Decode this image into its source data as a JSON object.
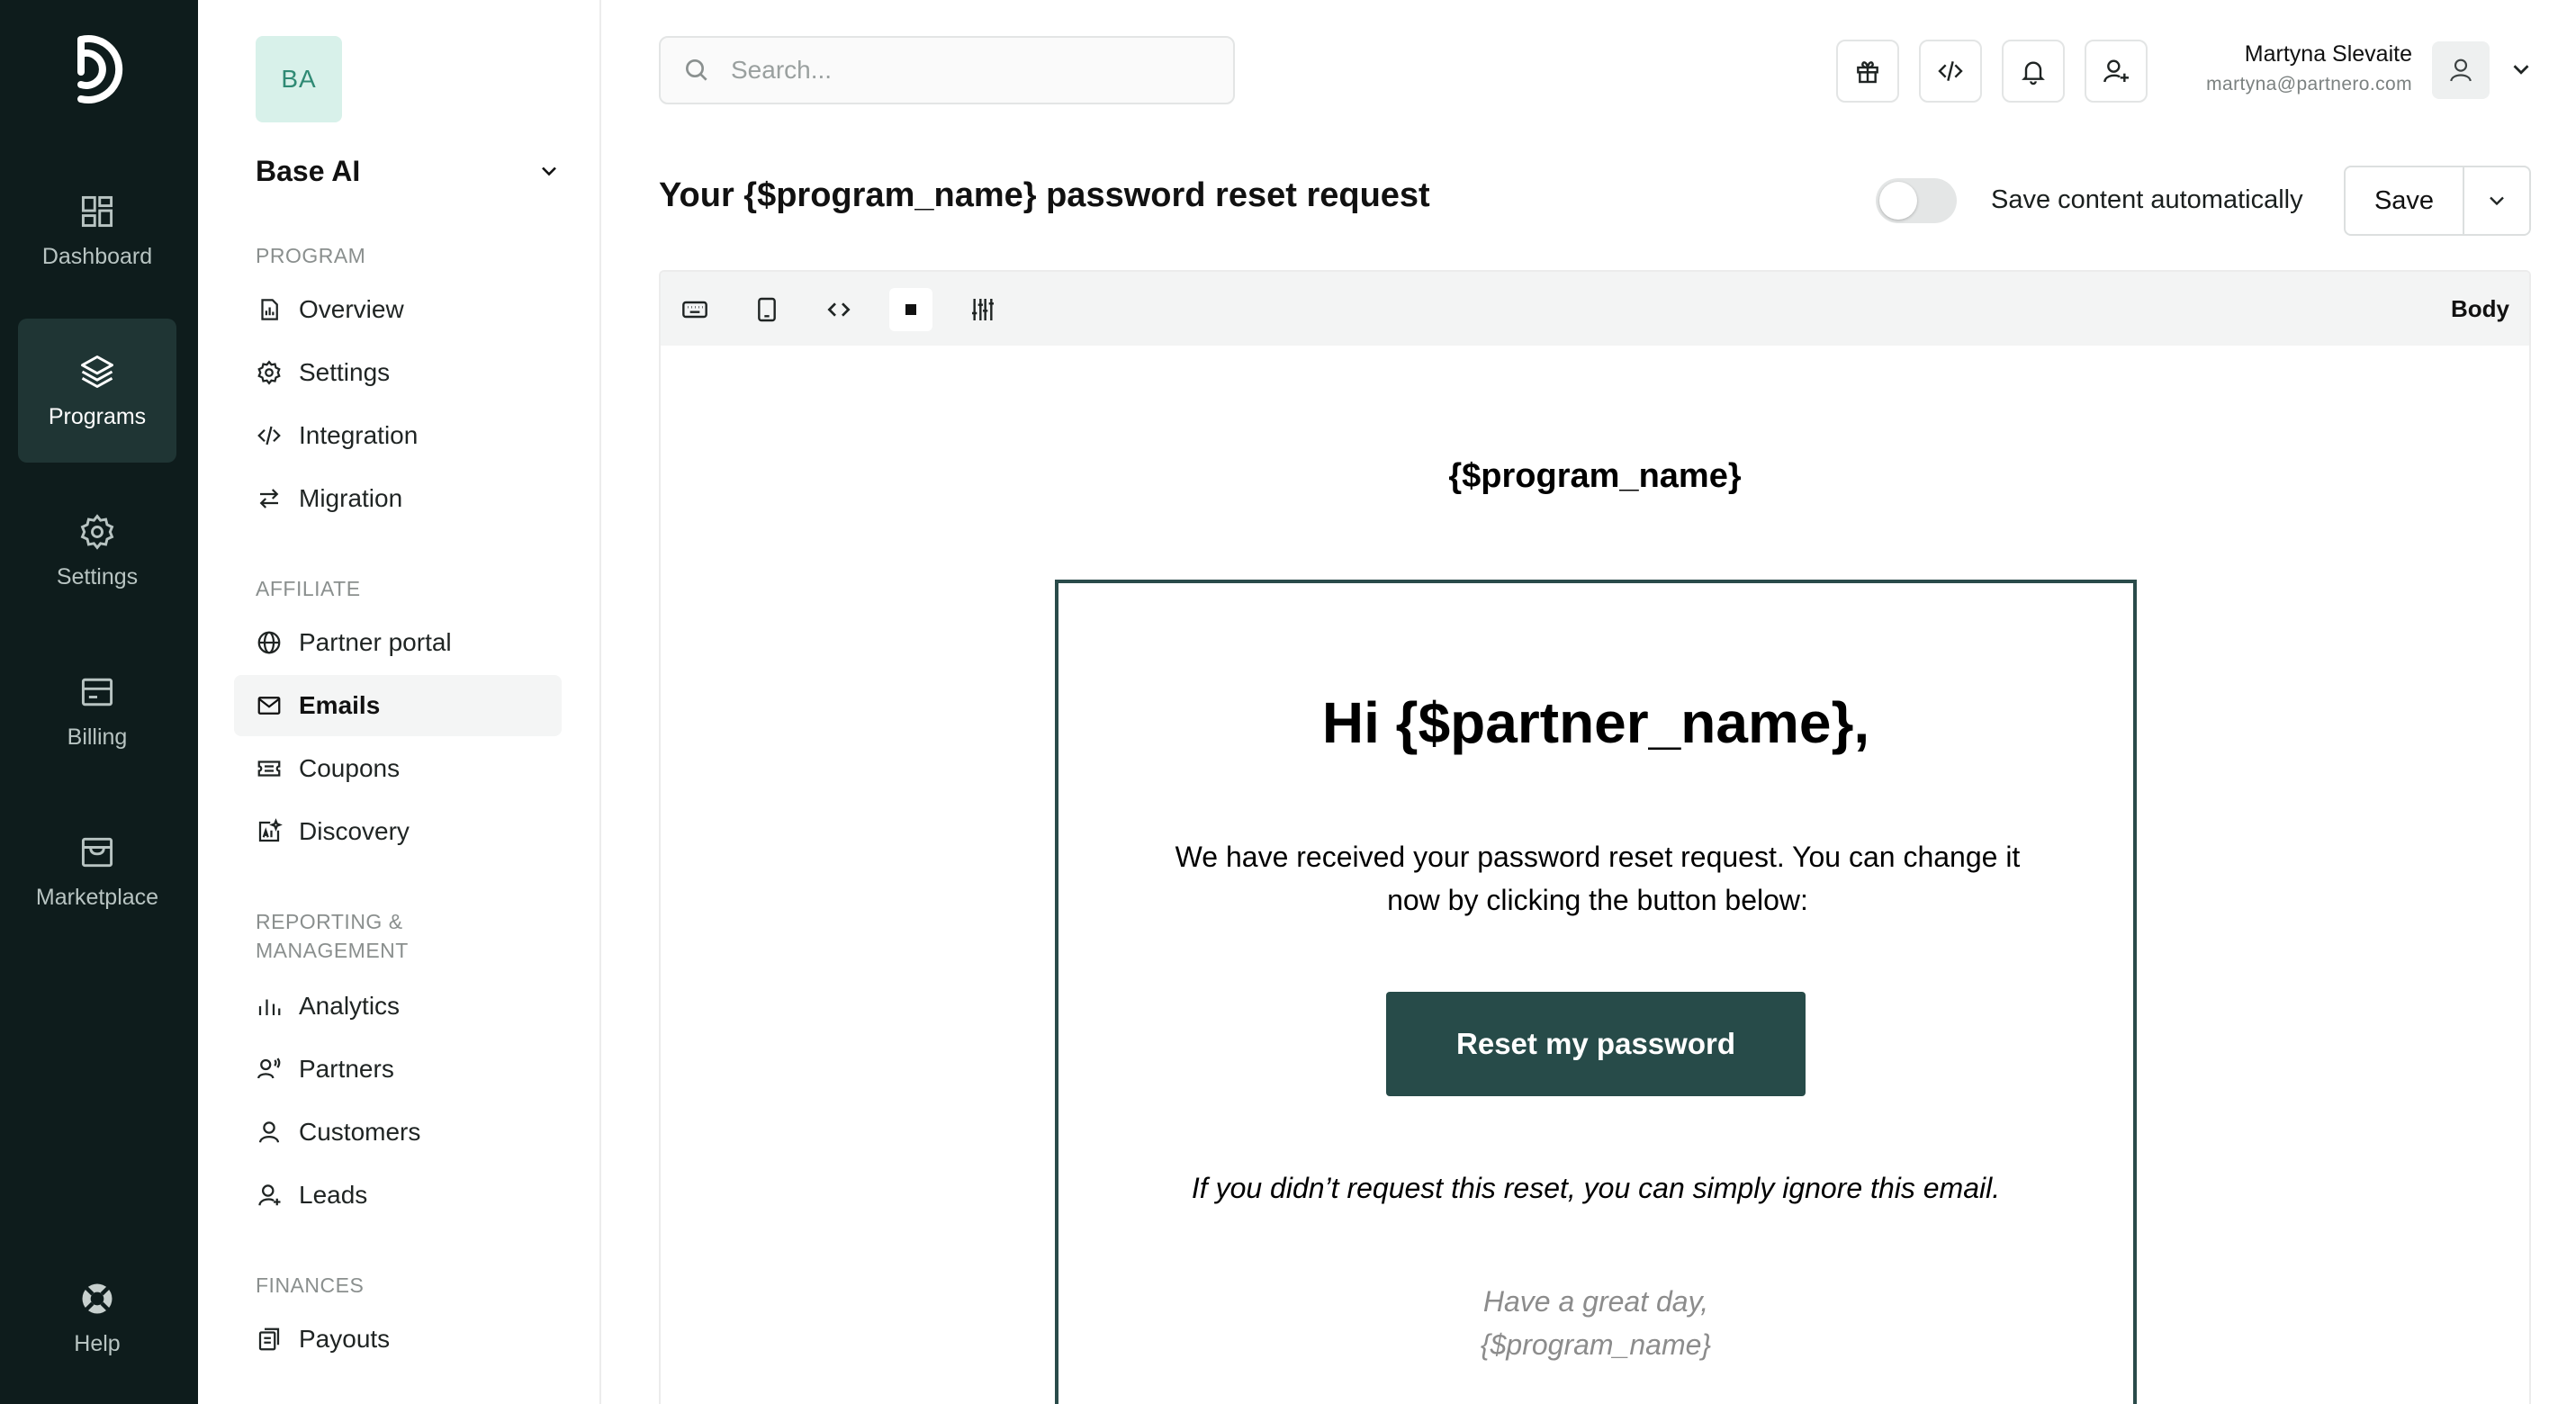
{
  "rail": {
    "items": [
      {
        "label": "Dashboard",
        "icon": "dashboard-icon",
        "active": false
      },
      {
        "label": "Programs",
        "icon": "layers-icon",
        "active": true
      },
      {
        "label": "Settings",
        "icon": "gear-icon",
        "active": false
      },
      {
        "label": "Billing",
        "icon": "billing-icon",
        "active": false
      },
      {
        "label": "Marketplace",
        "icon": "store-icon",
        "active": false
      }
    ],
    "help": {
      "label": "Help",
      "icon": "lifebuoy-icon"
    }
  },
  "sidebar": {
    "avatar": "BA",
    "org_name": "Base AI",
    "sections": [
      {
        "title": "PROGRAM"
      },
      {
        "title": "AFFILIATE"
      },
      {
        "title": "REPORTING &",
        "title2": "MANAGEMENT"
      },
      {
        "title": "FINANCES"
      }
    ],
    "items": [
      {
        "label": "Overview",
        "icon": "chart-doc-icon"
      },
      {
        "label": "Settings",
        "icon": "gear-icon"
      },
      {
        "label": "Integration",
        "icon": "code-icon"
      },
      {
        "label": "Migration",
        "icon": "arrows-swap-icon"
      },
      {
        "label": "Partner portal",
        "icon": "globe-icon"
      },
      {
        "label": "Emails",
        "icon": "mail-icon",
        "active": true
      },
      {
        "label": "Coupons",
        "icon": "coupon-icon"
      },
      {
        "label": "Discovery",
        "icon": "ai-discovery-icon"
      },
      {
        "label": "Analytics",
        "icon": "bar-chart-icon"
      },
      {
        "label": "Partners",
        "icon": "partners-icon"
      },
      {
        "label": "Customers",
        "icon": "customers-icon"
      },
      {
        "label": "Leads",
        "icon": "lead-icon"
      },
      {
        "label": "Payouts",
        "icon": "payouts-icon"
      }
    ]
  },
  "topbar": {
    "search_placeholder": "Search...",
    "user_name": "Martyna Slevaite",
    "user_email": "martyna@partnero.com"
  },
  "page": {
    "title": "Your {$program_name} password reset request",
    "autosave_label": "Save content automatically",
    "autosave_on": false,
    "save_label": "Save"
  },
  "editor": {
    "toolbar_right": "Body",
    "email": {
      "brand": "{$program_name}",
      "greeting": "Hi {$partner_name},",
      "body": "We have received your password reset request. You can change it now by clicking the button below:",
      "button": "Reset my password",
      "ignore": "If you didn’t request this reset, you can simply ignore this email.",
      "sign_line1": "Have a great day,",
      "sign_line2": "{$program_name}"
    }
  },
  "colors": {
    "rail_bg": "#0e1c1c",
    "rail_active": "#1f3534",
    "brand_button": "#274b49",
    "avatar_bg": "#d8f1ea",
    "avatar_text": "#2f8a74"
  }
}
